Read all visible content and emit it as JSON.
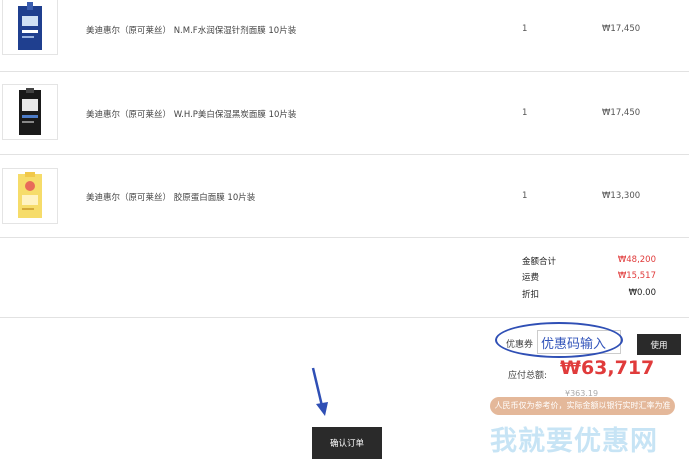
{
  "products": [
    {
      "name": "美迪惠尔（原可莱丝） N.M.F水润保湿针剂面膜 10片装",
      "qty": "1",
      "price": "₩17,450",
      "thumb": "blue-mask-pack"
    },
    {
      "name": "美迪惠尔（原可莱丝） W.H.P美白保湿黑炭面膜 10片装",
      "qty": "1",
      "price": "₩17,450",
      "thumb": "black-mask-pack"
    },
    {
      "name": "美迪惠尔（原可莱丝） 胶原蛋白面膜 10片装",
      "qty": "1",
      "price": "₩13,300",
      "thumb": "yellow-mask-pack"
    }
  ],
  "summary": {
    "subtotal_label": "金额合计",
    "subtotal_value": "₩48,200",
    "shipping_label": "运费",
    "shipping_value": "₩15,517",
    "discount_label": "折扣",
    "discount_value": "₩0.00"
  },
  "coupon": {
    "label": "优惠券",
    "input_value": "优惠码输入",
    "use_label": "使用"
  },
  "total": {
    "label": "应付总额:",
    "value": "₩63,717",
    "rmb_value": "¥363.19"
  },
  "notice": "人民币仅为参考价，实际金额以银行实时汇率为准",
  "confirm_label": "确认订单",
  "watermark": "我就要优惠网",
  "colors": {
    "accent_red": "#e03b3b",
    "annotation_blue": "#2f4fb5",
    "button_dark": "#2a2a2a"
  }
}
